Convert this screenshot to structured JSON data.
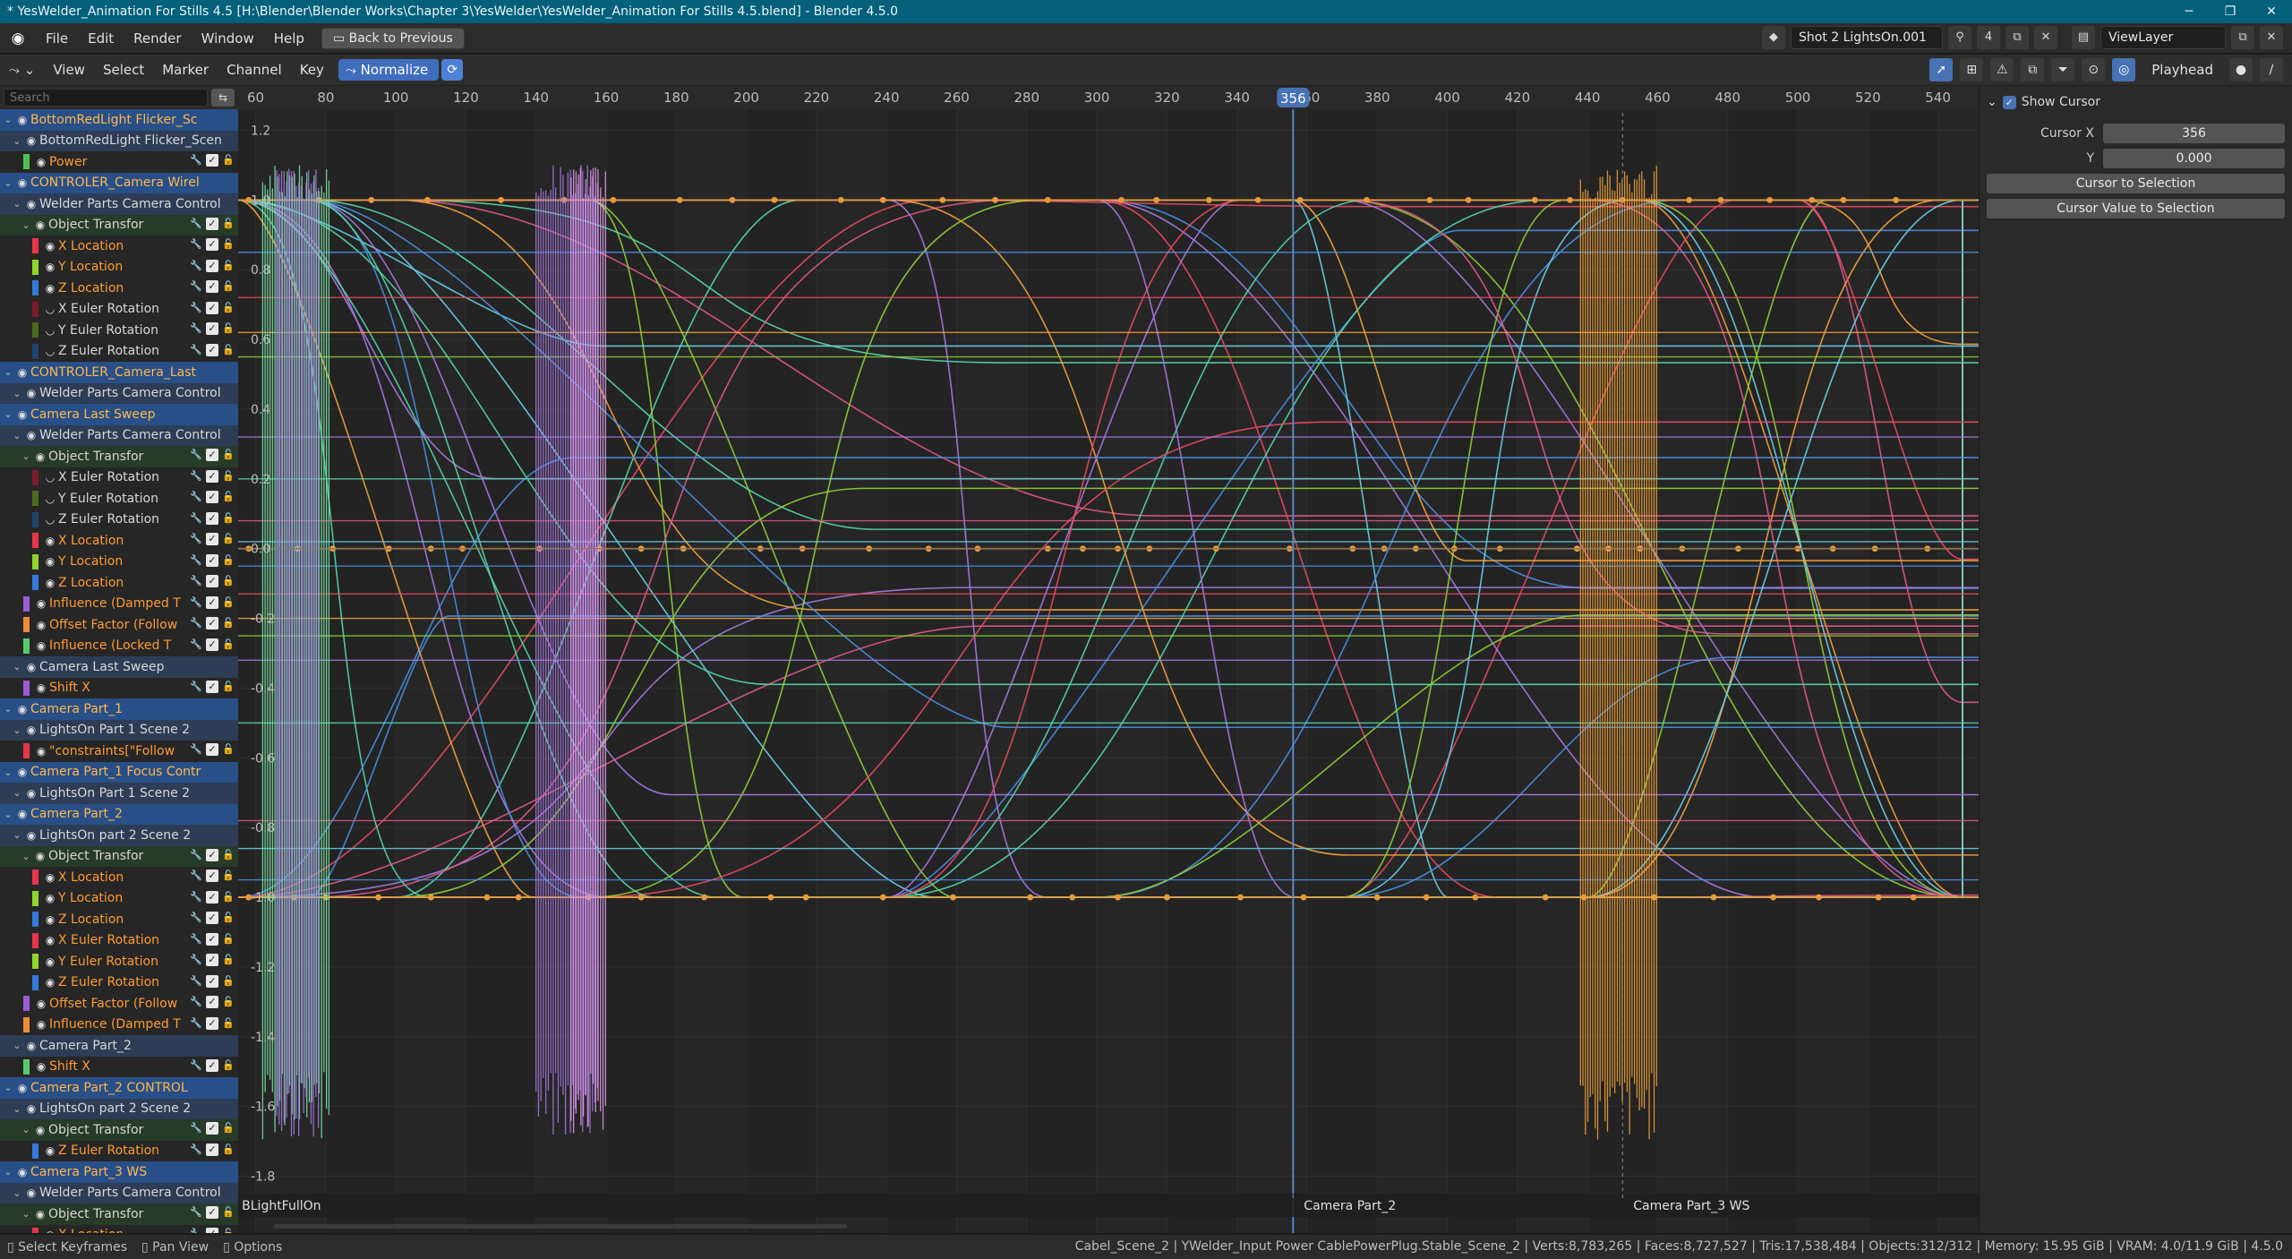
{
  "window": {
    "title": "* YesWelder_Animation For Stills 4.5 [H:\\Blender\\Blender Works\\Chapter 3\\YesWelder\\YesWelder_Animation For Stills 4.5.blend] - Blender 4.5.0",
    "minimize": "─",
    "maximize": "❐",
    "close": "✕"
  },
  "menu": {
    "file": "File",
    "edit": "Edit",
    "render": "Render",
    "window": "Window",
    "help": "Help",
    "back_to_previous": "Back to Previous"
  },
  "scene": {
    "name": "Shot 2 LightsOn.001",
    "users": "4",
    "view_layer": "ViewLayer"
  },
  "editor_header": {
    "view": "View",
    "select": "Select",
    "marker": "Marker",
    "channel": "Channel",
    "key": "Key",
    "normalize": "Normalize",
    "pivot": "Playhead"
  },
  "search": {
    "placeholder": "Search"
  },
  "channels": [
    {
      "t": "obj",
      "name": "BottomRedLight Flicker_Sc",
      "sw": "",
      "ind": 0
    },
    {
      "t": "act",
      "name": "BottomRedLight Flicker_Scen",
      "sw": "",
      "ind": 1
    },
    {
      "t": "ch",
      "name": "Power",
      "sw": "#4dc34d",
      "ind": 1
    },
    {
      "t": "obj",
      "name": "CONTROLER_Camera Wirel",
      "sw": "",
      "ind": 0
    },
    {
      "t": "act",
      "name": "Welder Parts Camera Control",
      "sw": "",
      "ind": 1
    },
    {
      "t": "grp",
      "name": "Object Transfor",
      "sw": "",
      "ind": 2
    },
    {
      "t": "ch",
      "name": "X Location",
      "sw": "#e8354a",
      "ind": 2
    },
    {
      "t": "ch",
      "name": "Y Location",
      "sw": "#8dd42d",
      "ind": 2
    },
    {
      "t": "ch",
      "name": "Z Location",
      "sw": "#3479d9",
      "ind": 2
    },
    {
      "t": "chw",
      "name": "X Euler Rotation",
      "sw": "#7a1d2b",
      "ind": 2
    },
    {
      "t": "chw",
      "name": "Y Euler Rotation",
      "sw": "#4d6a1f",
      "ind": 2
    },
    {
      "t": "chw",
      "name": "Z Euler Rotation",
      "sw": "#22446e",
      "ind": 2
    },
    {
      "t": "obj",
      "name": "CONTROLER_Camera_Last",
      "sw": "",
      "ind": 0
    },
    {
      "t": "act",
      "name": "Welder Parts Camera Control",
      "sw": "",
      "ind": 1
    },
    {
      "t": "obj",
      "name": "Camera Last Sweep",
      "sw": "",
      "ind": 0
    },
    {
      "t": "act",
      "name": "Welder Parts Camera Control",
      "sw": "",
      "ind": 1
    },
    {
      "t": "grp",
      "name": "Object Transfor",
      "sw": "",
      "ind": 2
    },
    {
      "t": "chw",
      "name": "X Euler Rotation",
      "sw": "#7a1d2b",
      "ind": 2
    },
    {
      "t": "chw",
      "name": "Y Euler Rotation",
      "sw": "#4d6a1f",
      "ind": 2
    },
    {
      "t": "chw",
      "name": "Z Euler Rotation",
      "sw": "#22446e",
      "ind": 2
    },
    {
      "t": "ch",
      "name": "X Location",
      "sw": "#e8354a",
      "ind": 2
    },
    {
      "t": "ch",
      "name": "Y Location",
      "sw": "#8dd42d",
      "ind": 2
    },
    {
      "t": "ch",
      "name": "Z Location",
      "sw": "#3479d9",
      "ind": 2
    },
    {
      "t": "ch",
      "name": "Influence (Damped T",
      "sw": "#9b5ad6",
      "ind": 1
    },
    {
      "t": "ch",
      "name": "Offset Factor (Follow",
      "sw": "#f08c30",
      "ind": 1
    },
    {
      "t": "ch",
      "name": "Influence (Locked T",
      "sw": "#56c96a",
      "ind": 1
    },
    {
      "t": "act",
      "name": "Camera Last Sweep",
      "sw": "",
      "ind": 1
    },
    {
      "t": "ch",
      "name": "Shift X",
      "sw": "#9b5ad6",
      "ind": 1
    },
    {
      "t": "obj",
      "name": "Camera Part_1",
      "sw": "",
      "ind": 0
    },
    {
      "t": "act",
      "name": "LightsOn Part 1 Scene 2",
      "sw": "",
      "ind": 1
    },
    {
      "t": "ch",
      "name": "\"constraints[\"Follow",
      "sw": "#e8354a",
      "ind": 1
    },
    {
      "t": "obj",
      "name": "Camera Part_1 Focus Contr",
      "sw": "",
      "ind": 0
    },
    {
      "t": "act",
      "name": "LightsOn Part 1 Scene 2",
      "sw": "",
      "ind": 1
    },
    {
      "t": "obj",
      "name": "Camera Part_2",
      "sw": "",
      "ind": 0
    },
    {
      "t": "act",
      "name": "LightsOn part 2 Scene 2",
      "sw": "",
      "ind": 1
    },
    {
      "t": "grp",
      "name": "Object Transfor",
      "sw": "",
      "ind": 2
    },
    {
      "t": "ch",
      "name": "X Location",
      "sw": "#e8354a",
      "ind": 2
    },
    {
      "t": "ch",
      "name": "Y Location",
      "sw": "#8dd42d",
      "ind": 2
    },
    {
      "t": "ch",
      "name": "Z Location",
      "sw": "#3479d9",
      "ind": 2
    },
    {
      "t": "ch",
      "name": "X Euler Rotation",
      "sw": "#e8354a",
      "ind": 2
    },
    {
      "t": "ch",
      "name": "Y Euler Rotation",
      "sw": "#8dd42d",
      "ind": 2
    },
    {
      "t": "ch",
      "name": "Z Euler Rotation",
      "sw": "#3479d9",
      "ind": 2
    },
    {
      "t": "ch",
      "name": "Offset Factor (Follow",
      "sw": "#9b5ad6",
      "ind": 1
    },
    {
      "t": "ch",
      "name": "Influence (Damped T",
      "sw": "#f08c30",
      "ind": 1
    },
    {
      "t": "act",
      "name": "Camera Part_2",
      "sw": "",
      "ind": 1
    },
    {
      "t": "ch",
      "name": "Shift X",
      "sw": "#56c96a",
      "ind": 1
    },
    {
      "t": "obj",
      "name": "Camera Part_2 CONTROL",
      "sw": "",
      "ind": 0
    },
    {
      "t": "act",
      "name": "LightsOn part 2 Scene 2",
      "sw": "",
      "ind": 1
    },
    {
      "t": "grp",
      "name": "Object Transfor",
      "sw": "",
      "ind": 2
    },
    {
      "t": "ch",
      "name": "Z Euler Rotation",
      "sw": "#3479d9",
      "ind": 2
    },
    {
      "t": "obj",
      "name": "Camera Part_3 WS",
      "sw": "",
      "ind": 0
    },
    {
      "t": "act",
      "name": "Welder Parts Camera Control",
      "sw": "",
      "ind": 1
    },
    {
      "t": "grp",
      "name": "Object Transfor",
      "sw": "",
      "ind": 2
    },
    {
      "t": "ch",
      "name": "X Location",
      "sw": "#e8354a",
      "ind": 2
    }
  ],
  "timeline": {
    "frames": [
      "60",
      "80",
      "100",
      "120",
      "140",
      "160",
      "180",
      "200",
      "220",
      "240",
      "260",
      "280",
      "300",
      "320",
      "340",
      "360",
      "380",
      "400",
      "420",
      "440",
      "460",
      "480",
      "500",
      "520",
      "540"
    ],
    "current_frame": "356",
    "values": [
      "1.2",
      "1.0",
      "0.8",
      "0.6",
      "0.4",
      "0.2",
      "0.0",
      "-0.2",
      "-0.4",
      "-0.6",
      "-0.8",
      "-1.0",
      "-1.2",
      "-1.4",
      "-1.6",
      "-1.8"
    ],
    "markers": [
      {
        "label": "BLightFullOn",
        "frame": 53
      },
      {
        "label": "Camera Part_2",
        "frame": 356
      },
      {
        "label": "Camera Part_3 WS",
        "frame": 450
      }
    ]
  },
  "curve_colors": [
    "#4a8fe0",
    "#e84a5f",
    "#f3a33c",
    "#8ed13a",
    "#a77ae0",
    "#56d6a8",
    "#e05a8a",
    "#6ad0e8"
  ],
  "sidebar": {
    "show_cursor": "Show Cursor",
    "cursor_x_label": "Cursor X",
    "cursor_x": "356",
    "y_label": "Y",
    "y": "0.000",
    "cursor_to_selection": "Cursor to Selection",
    "cursor_value_to_selection": "Cursor Value to Selection"
  },
  "status": {
    "select_keyframes": "Select Keyframes",
    "pan_view": "Pan View",
    "options": "Options",
    "info": "Cabel_Scene_2 | YWelder_Input Power CablePowerPlug.Stable_Scene_2 | Verts:8,783,265 | Faces:8,727,527 | Tris:17,538,484 | Objects:312/312 | Memory: 15.95 GiB | VRAM: 4.0/11.9 GiB | 4.5.0"
  }
}
